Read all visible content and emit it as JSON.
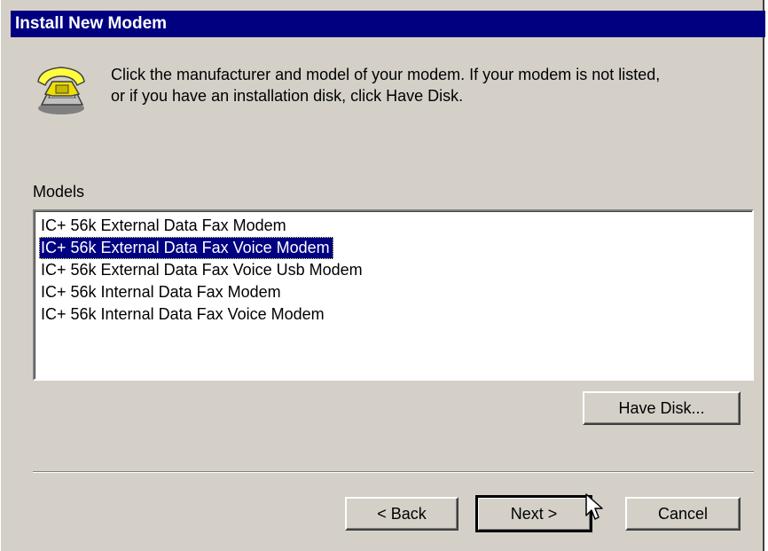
{
  "dialog": {
    "title": "Install New Modem",
    "instruction_line1": "Click the manufacturer and model of your modem. If your modem is not listed,",
    "instruction_line2": "or if you have an installation disk, click Have Disk."
  },
  "models": {
    "label": "Models",
    "items": [
      "IC+ 56k External Data Fax Modem",
      "IC+ 56k External Data Fax Voice Modem",
      "IC+ 56k External Data Fax Voice Usb Modem",
      "IC+ 56k Internal Data Fax Modem",
      "IC+ 56k Internal Data Fax Voice Modem"
    ],
    "selected": "IC+ 56k External Data Fax Voice Modem"
  },
  "buttons": {
    "have_disk": "Have Disk...",
    "back": "< Back",
    "next": "Next >",
    "cancel": "Cancel"
  },
  "colors": {
    "titlebar": "#000080",
    "dialog_bg": "#d4d0c8",
    "selection": "#000080"
  },
  "icons": [
    "telephone-icon",
    "mouse-pointer-icon"
  ]
}
